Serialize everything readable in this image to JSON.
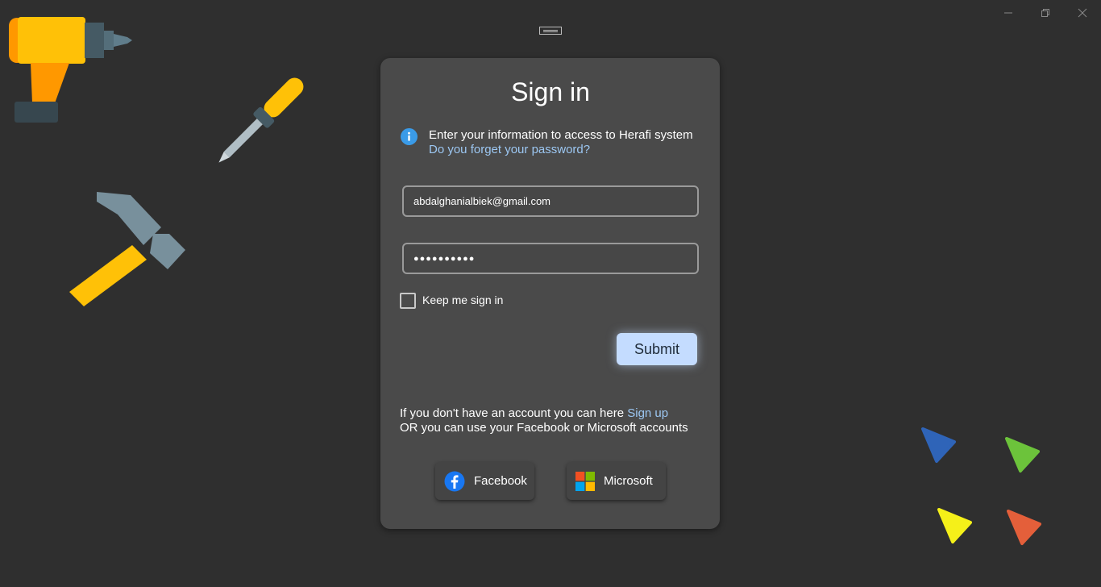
{
  "window": {
    "minimize_icon": "minimize-icon",
    "restore_icon": "restore-icon",
    "close_icon": "close-icon"
  },
  "signin": {
    "title": "Sign in",
    "info_line": "Enter your information to access to Herafi system",
    "forgot_link": "Do you forget your password?",
    "email_value": "abdalghanialbiek@gmail.com",
    "password_mask": "●●●●●●●●●●",
    "keep_signed_in_label": "Keep me sign in",
    "keep_signed_in_checked": false,
    "submit_label": "Submit",
    "signup_prefix": "If you don't have an account you can here ",
    "signup_link": "Sign up",
    "alternative_line": "OR you can use your Facebook or Microsoft accounts",
    "facebook_label": "Facebook",
    "microsoft_label": "Microsoft"
  },
  "colors": {
    "background": "#2f2f2f",
    "card": "#4a4a4a",
    "accent_link": "#9cc7f2",
    "submit_bg": "#c4dcff",
    "info_icon": "#3a9be8"
  },
  "decorations": [
    "drill-icon",
    "screwdriver-icon",
    "hammer-icon",
    "blue-triangle",
    "green-triangle",
    "yellow-triangle",
    "orange-triangle"
  ]
}
